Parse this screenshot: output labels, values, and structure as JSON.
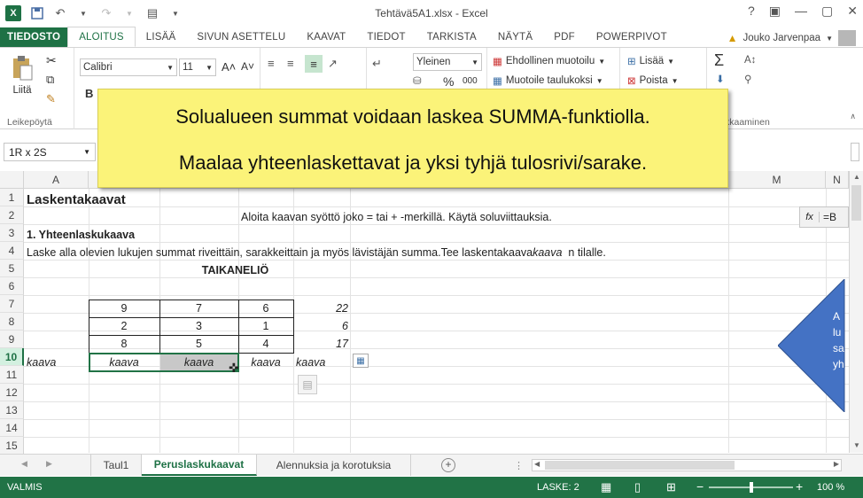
{
  "window": {
    "app_logo": "X",
    "title": "Tehtävä5A1.xlsx - Excel",
    "controls": [
      "?",
      "▣",
      "—",
      "▢",
      "✕"
    ]
  },
  "ribbon_tabs": [
    "TIEDOSTO",
    "ALOITUS",
    "LISÄÄ",
    "SIVUN ASETTELU",
    "KAAVAT",
    "TIEDOT",
    "TARKISTA",
    "NÄYTÄ",
    "PDF",
    "POWERPIVOT"
  ],
  "user": {
    "name": "Jouko Jarvenpaa"
  },
  "ribbon": {
    "paste_label": "Liitä",
    "clipboard_group": "Leikepöytä",
    "font_name": "Calibri",
    "font_size": "11",
    "grow_font": "A˄",
    "shrink_font": "A˅",
    "bold": "B",
    "number_format": "Yleinen",
    "percent": "%",
    "thousands": "000",
    "conditional_format": "Ehdollinen muotoilu",
    "format_table": "Muotoile taulukoksi",
    "insert": "Lisää",
    "delete": "Poista",
    "editing_group_partial": "kkaaminen",
    "sum_symbol": "Σ"
  },
  "formula_bar": {
    "name_box": "1R x 2S",
    "popup_fx": "fx",
    "popup_value": "=B"
  },
  "columns": [
    "A",
    "M",
    "N"
  ],
  "rows": [
    "1",
    "2",
    "3",
    "4",
    "5",
    "6",
    "7",
    "8",
    "9",
    "10",
    "11",
    "12",
    "13",
    "14",
    "15"
  ],
  "cells": {
    "a1": "Laskentakaavat",
    "b2": "Aloita kaavan syöttö joko = tai + -merkillä. Käytä soluviittauksia.",
    "a3": "1. Yhteenlaskukaava",
    "a4_part1": "Laske alla olevien lukujen summat riveittäin, sarakkeittain ja myös lävistäjän summa.Tee laskentakaava ",
    "a4_italic": "kaava",
    "a4_part2": "  n tilalle.",
    "title5": "TAIKANELIÖ",
    "r7": [
      "9",
      "7",
      "6",
      "22"
    ],
    "r8": [
      "2",
      "3",
      "1",
      "6"
    ],
    "r9": [
      "8",
      "5",
      "4",
      "17"
    ],
    "r10": [
      "kaava",
      "kaava",
      "kaava",
      "kaava",
      "kaava"
    ]
  },
  "callout": {
    "line1": "Solualueen summat voidaan laskea SUMMA-funktiolla.",
    "line2": "Maalaa yhteenlaskettavat ja yksi tyhjä tulosrivi/sarake."
  },
  "side_shape_text": [
    "A",
    "lu",
    "sa",
    "yh"
  ],
  "sheet_tabs": [
    "Taul1",
    "Peruslaskukaavat",
    "Alennuksia ja korotuksia"
  ],
  "active_sheet": "Peruslaskukaavat",
  "status": {
    "mode": "VALMIS",
    "count": "LASKE: 2",
    "zoom": "100 %",
    "zoom_level_percent": 100
  },
  "colors": {
    "excel_green": "#217346",
    "callout_yellow": "#fbf379",
    "shape_blue": "#4472c4"
  }
}
